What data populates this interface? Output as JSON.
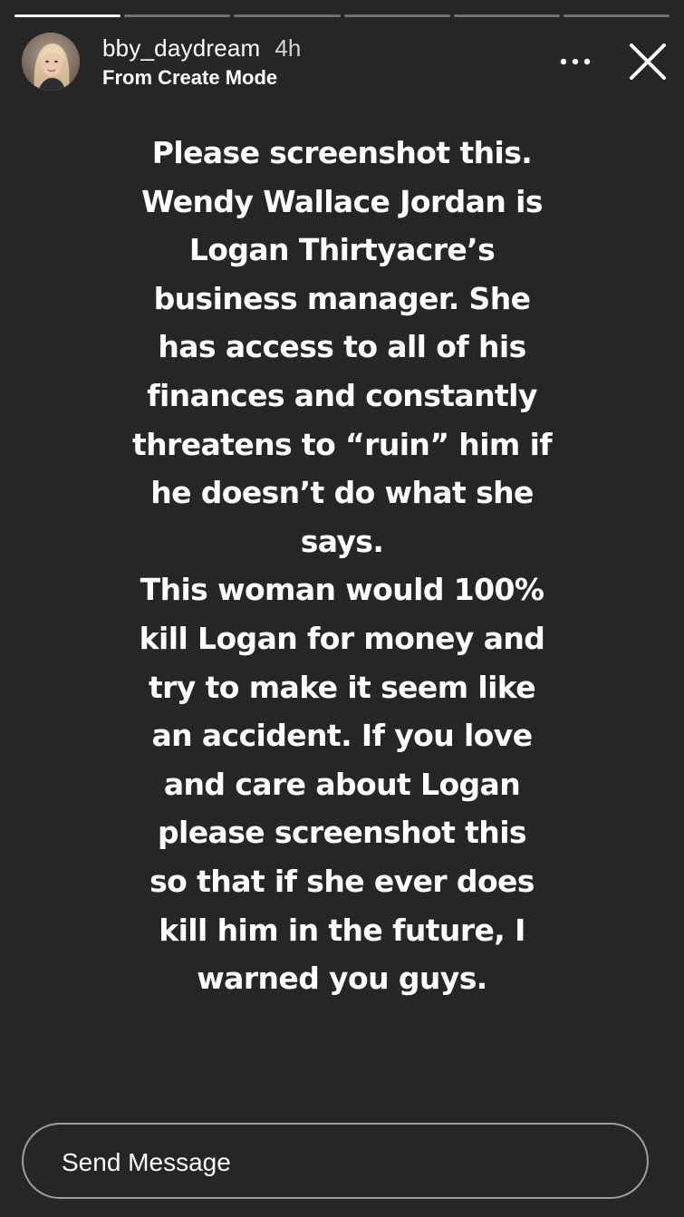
{
  "progress": {
    "segments": [
      1,
      0,
      0,
      0,
      0,
      0
    ],
    "current_index": 0
  },
  "header": {
    "username": "bby_daydream",
    "time_ago": "4h",
    "subtitle": "From Create Mode",
    "more_icon": "more-horizontal-icon",
    "close_icon": "close-icon"
  },
  "story": {
    "lines": [
      "Please screenshot this.",
      "Wendy Wallace Jordan is",
      "Logan Thirtyacre’s",
      "business manager. She",
      "has access to all of his",
      "finances and constantly",
      "threatens to “ruin” him if",
      "he doesn’t do what she",
      "says.",
      "This woman would 100%",
      "kill Logan for money and",
      "try to make it seem like",
      "an accident. If you love",
      "and care about Logan",
      "please screenshot this",
      "so that if she ever does",
      "kill him in the future, I",
      "warned you guys."
    ],
    "background_color": "#262626",
    "text_color": "#ffffff"
  },
  "reply": {
    "placeholder": "Send Message"
  }
}
